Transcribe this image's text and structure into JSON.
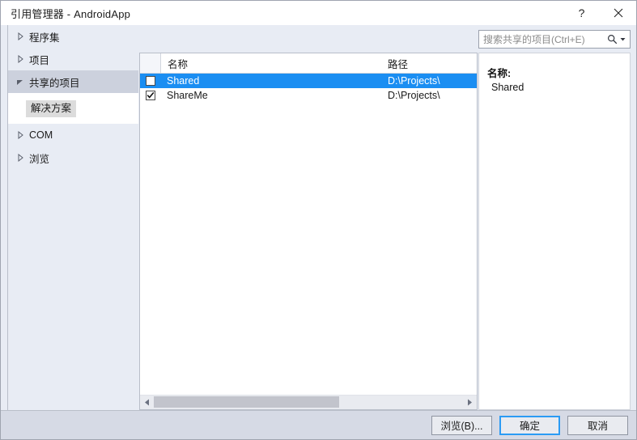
{
  "window": {
    "title": "引用管理器 - AndroidApp",
    "help_label": "?",
    "close_label": "✕"
  },
  "sidebar": {
    "items": [
      {
        "label": "程序集",
        "expanded": false,
        "selected": false
      },
      {
        "label": "项目",
        "expanded": false,
        "selected": false
      },
      {
        "label": "共享的项目",
        "expanded": true,
        "selected": true
      },
      {
        "label": "COM",
        "expanded": false,
        "selected": false
      },
      {
        "label": "浏览",
        "expanded": false,
        "selected": false
      }
    ],
    "child": {
      "label": "解决方案",
      "highlighted": true
    }
  },
  "search": {
    "placeholder": "搜索共享的项目(Ctrl+E)",
    "value": "",
    "icon": "search-icon",
    "dropdown_icon": "chevron-down-icon"
  },
  "list": {
    "columns": [
      "名称",
      "路径"
    ],
    "rows": [
      {
        "checked": false,
        "name": "Shared",
        "path": "D:\\Projects\\",
        "selected": true
      },
      {
        "checked": true,
        "name": "ShareMe",
        "path": "D:\\Projects\\",
        "selected": false
      }
    ],
    "scrollbar": {
      "thumb_percent": 60
    }
  },
  "details": {
    "label": "名称:",
    "value": "Shared"
  },
  "footer": {
    "browse_label": "浏览(B)...",
    "ok_label": "确定",
    "cancel_label": "取消"
  },
  "colors": {
    "selection_blue": "#1b8ef2",
    "focus_border": "#2b9bf4",
    "sidebar_bg": "#e8ecf4",
    "footer_bg": "#d6dae5"
  }
}
